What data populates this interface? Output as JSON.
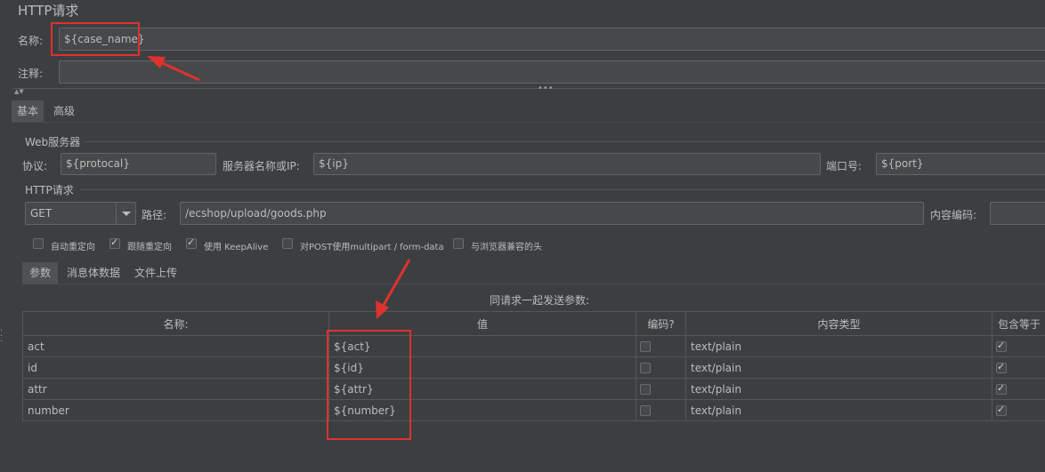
{
  "title": "HTTP请求",
  "name": {
    "label": "名称:",
    "value": "${case_name}"
  },
  "comment": {
    "label": "注释:",
    "value": ""
  },
  "tabs": [
    {
      "label": "基本"
    },
    {
      "label": "高级"
    }
  ],
  "web_server": {
    "group_label": "Web服务器",
    "protocol_label": "协议:",
    "protocol_value": "${protocal}",
    "server_label": "服务器名称或IP:",
    "server_value": "${ip}",
    "port_label": "端口号:",
    "port_value": "${port}"
  },
  "http_request": {
    "group_label": "HTTP请求",
    "method": "GET",
    "path_label": "路径:",
    "path_value": "/ecshop/upload/goods.php",
    "encoding_label": "内容编码:",
    "encoding_value": ""
  },
  "options": [
    {
      "label": "自动重定向",
      "checked": false
    },
    {
      "label": "跟随重定向",
      "checked": true
    },
    {
      "label": "使用 KeepAlive",
      "checked": true
    },
    {
      "label": "对POST使用multipart / form-data",
      "checked": false
    },
    {
      "label": "与浏览器兼容的头",
      "checked": false
    }
  ],
  "sub_tabs": [
    {
      "label": "参数"
    },
    {
      "label": "消息体数据"
    },
    {
      "label": "文件上传"
    }
  ],
  "params": {
    "caption": "同请求一起发送参数:",
    "headers": [
      "名称:",
      "值",
      "编码?",
      "内容类型",
      "包含等于"
    ],
    "rows": [
      {
        "name": "act",
        "value": "${act}",
        "encode": false,
        "content_type": "text/plain",
        "include_equals": true
      },
      {
        "name": "id",
        "value": "${id}",
        "encode": false,
        "content_type": "text/plain",
        "include_equals": true
      },
      {
        "name": "attr",
        "value": "${attr}",
        "encode": false,
        "content_type": "text/plain",
        "include_equals": true
      },
      {
        "name": "number",
        "value": "${number}",
        "encode": false,
        "content_type": "text/plain",
        "include_equals": true
      }
    ]
  },
  "colors": {
    "background": "#3c3f41",
    "field": "#45494a",
    "annotation": "#e0312e"
  }
}
